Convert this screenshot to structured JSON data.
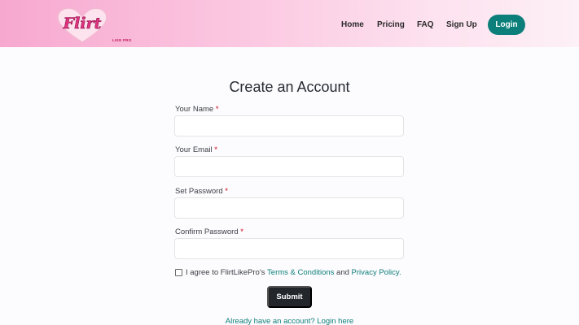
{
  "brand": {
    "logo_text": "Flirt",
    "logo_sub": "LIKE PRO"
  },
  "nav": {
    "home": "Home",
    "pricing": "Pricing",
    "faq": "FAQ",
    "signup": "Sign Up",
    "login": "Login"
  },
  "form": {
    "title": "Create an Account",
    "name_label": "Your Name",
    "email_label": "Your Email",
    "password_label": "Set Password",
    "confirm_label": "Confirm Password",
    "required_mark": "*",
    "name_value": "",
    "email_value": "",
    "password_value": "",
    "confirm_value": "",
    "agree_prefix": "I agree to FlirtLikePro's",
    "terms_link": "Terms & Conditions",
    "agree_and": "and",
    "privacy_link": "Privacy Policy.",
    "agree_checked": false,
    "submit_label": "Submit",
    "login_prompt": "Already have an account? Login here"
  },
  "colors": {
    "accent": "#0d7f7a",
    "header_pink": "#f7a8cf",
    "submit_bg": "#23262b",
    "required": "#d0021b"
  }
}
